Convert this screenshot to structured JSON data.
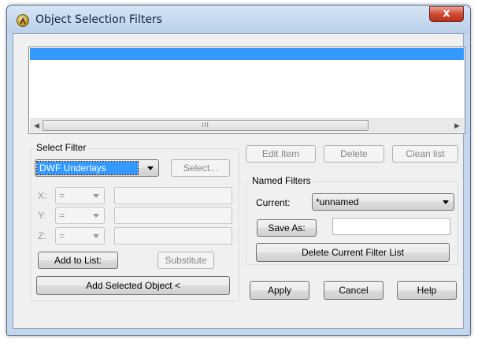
{
  "window": {
    "title": "Object Selection Filters",
    "close_glyph": "x"
  },
  "list": {
    "scroll_left_glyph": "◀",
    "scroll_right_glyph": "▶",
    "thumb_grip": "III"
  },
  "select_filter": {
    "group_label": "Select Filter",
    "type_value": "DWF Underlays",
    "select_button": "Select...",
    "axes": [
      {
        "label": "X:",
        "operator": "="
      },
      {
        "label": "Y:",
        "operator": "="
      },
      {
        "label": "Z:",
        "operator": "="
      }
    ],
    "add_to_list_button": "Add to List:",
    "substitute_button": "Substitute",
    "add_selected_button": "Add Selected Object <"
  },
  "list_actions": {
    "edit_item_button": "Edit Item",
    "delete_button": "Delete",
    "clean_list_button": "Clean list"
  },
  "named_filters": {
    "group_label": "Named Filters",
    "current_label": "Current:",
    "current_value": "*unnamed",
    "save_as_button": "Save As:",
    "save_as_value": "",
    "delete_current_button": "Delete Current Filter List"
  },
  "footer": {
    "apply_button": "Apply",
    "cancel_button": "Cancel",
    "help_button": "Help"
  },
  "colors": {
    "selection": "#3399ff",
    "frame": "#c4d6ec",
    "close": "#cf4a32"
  }
}
